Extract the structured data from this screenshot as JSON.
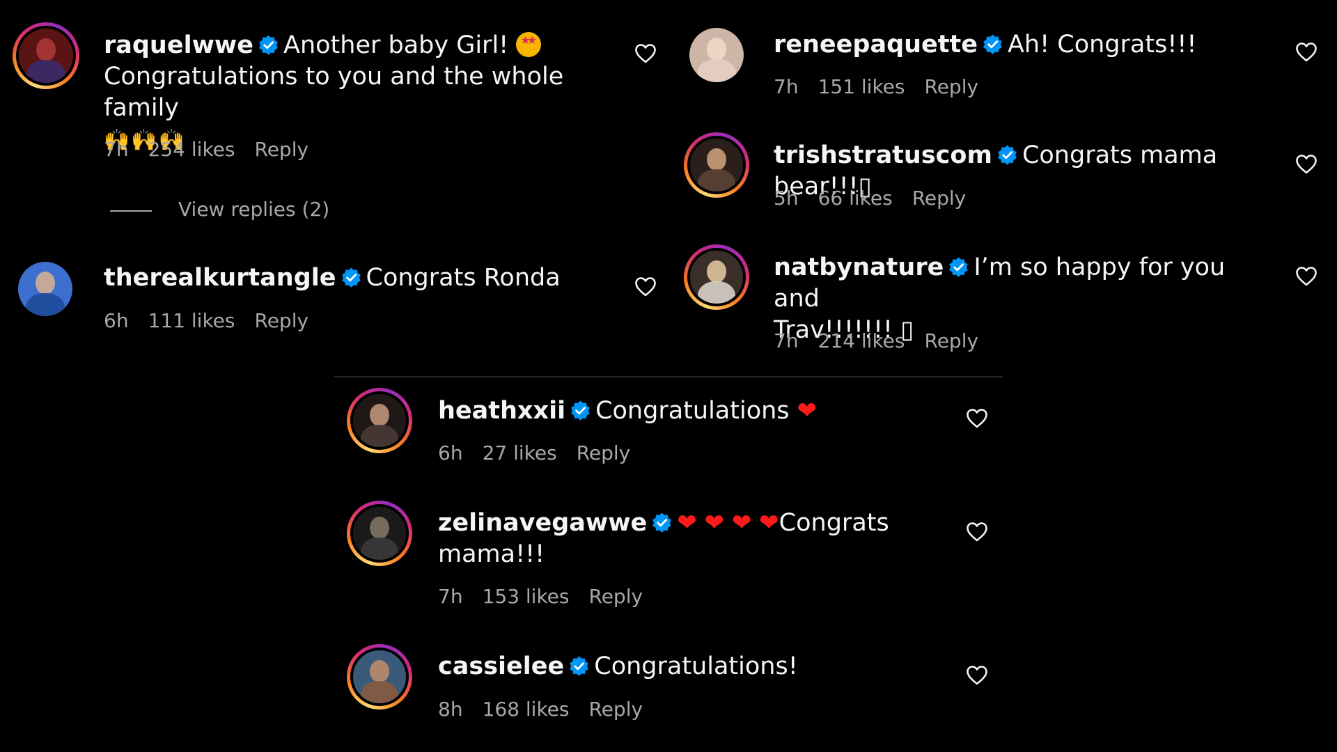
{
  "comments": [
    {
      "username": "raquelwwe",
      "text": "Another baby Girl!",
      "text_line2": "Congratulations to you and the whole family",
      "emoji_line": "🙌🙌🙌",
      "time": "7h",
      "likes": "254 likes",
      "reply_label": "Reply",
      "view_replies": "View replies (2)",
      "avatar_colors": [
        "#7a1b1b",
        "#3b2a6a"
      ]
    },
    {
      "username": "therealkurtangle",
      "text": "Congrats Ronda",
      "time": "6h",
      "likes": "111 likes",
      "reply_label": "Reply",
      "avatar_colors": [
        "#c9a98a",
        "#2b57a8"
      ]
    },
    {
      "username": "reneepaquette",
      "text": "Ah! Congrats!!!",
      "time": "7h",
      "likes": "151 likes",
      "reply_label": "Reply",
      "avatar_colors": [
        "#e8d7c7",
        "#d9b8a8"
      ]
    },
    {
      "username": "trishstratuscom",
      "text": "Congrats mama bear!!!▯",
      "time": "5h",
      "likes": "66 likes",
      "reply_label": "Reply",
      "avatar_colors": [
        "#caa27a",
        "#3a2a22"
      ]
    },
    {
      "username": "natbynature",
      "text": "I’m so happy for you and",
      "text_line2": "Trav!!!!!!! ▯",
      "time": "7h",
      "likes": "214 likes",
      "reply_label": "Reply",
      "avatar_colors": [
        "#e6c9a0",
        "#6b5a4a"
      ]
    },
    {
      "username": "heathxxii",
      "text": "Congratulations",
      "time": "6h",
      "likes": "27 likes",
      "reply_label": "Reply",
      "avatar_colors": [
        "#c79b82",
        "#4a3a36"
      ]
    },
    {
      "username": "zelinavegawwe",
      "text": "Congrats",
      "text_line2": "mama!!!",
      "time": "7h",
      "likes": "153 likes",
      "reply_label": "Reply",
      "avatar_colors": [
        "#8a7a6a",
        "#2a2a2a"
      ]
    },
    {
      "username": "cassielee",
      "text": "Congratulations!",
      "time": "8h",
      "likes": "168 likes",
      "reply_label": "Reply",
      "avatar_colors": [
        "#b98a6a",
        "#3a5a7a"
      ]
    }
  ],
  "colors": {
    "background": "#000000",
    "text": "#f5f5f5",
    "meta": "#a8a8a8",
    "verified": "#0095f6",
    "heart_red": "#ff1a1a"
  },
  "icons": {
    "verified": "verified-badge-icon",
    "like": "heart-outline-icon"
  }
}
